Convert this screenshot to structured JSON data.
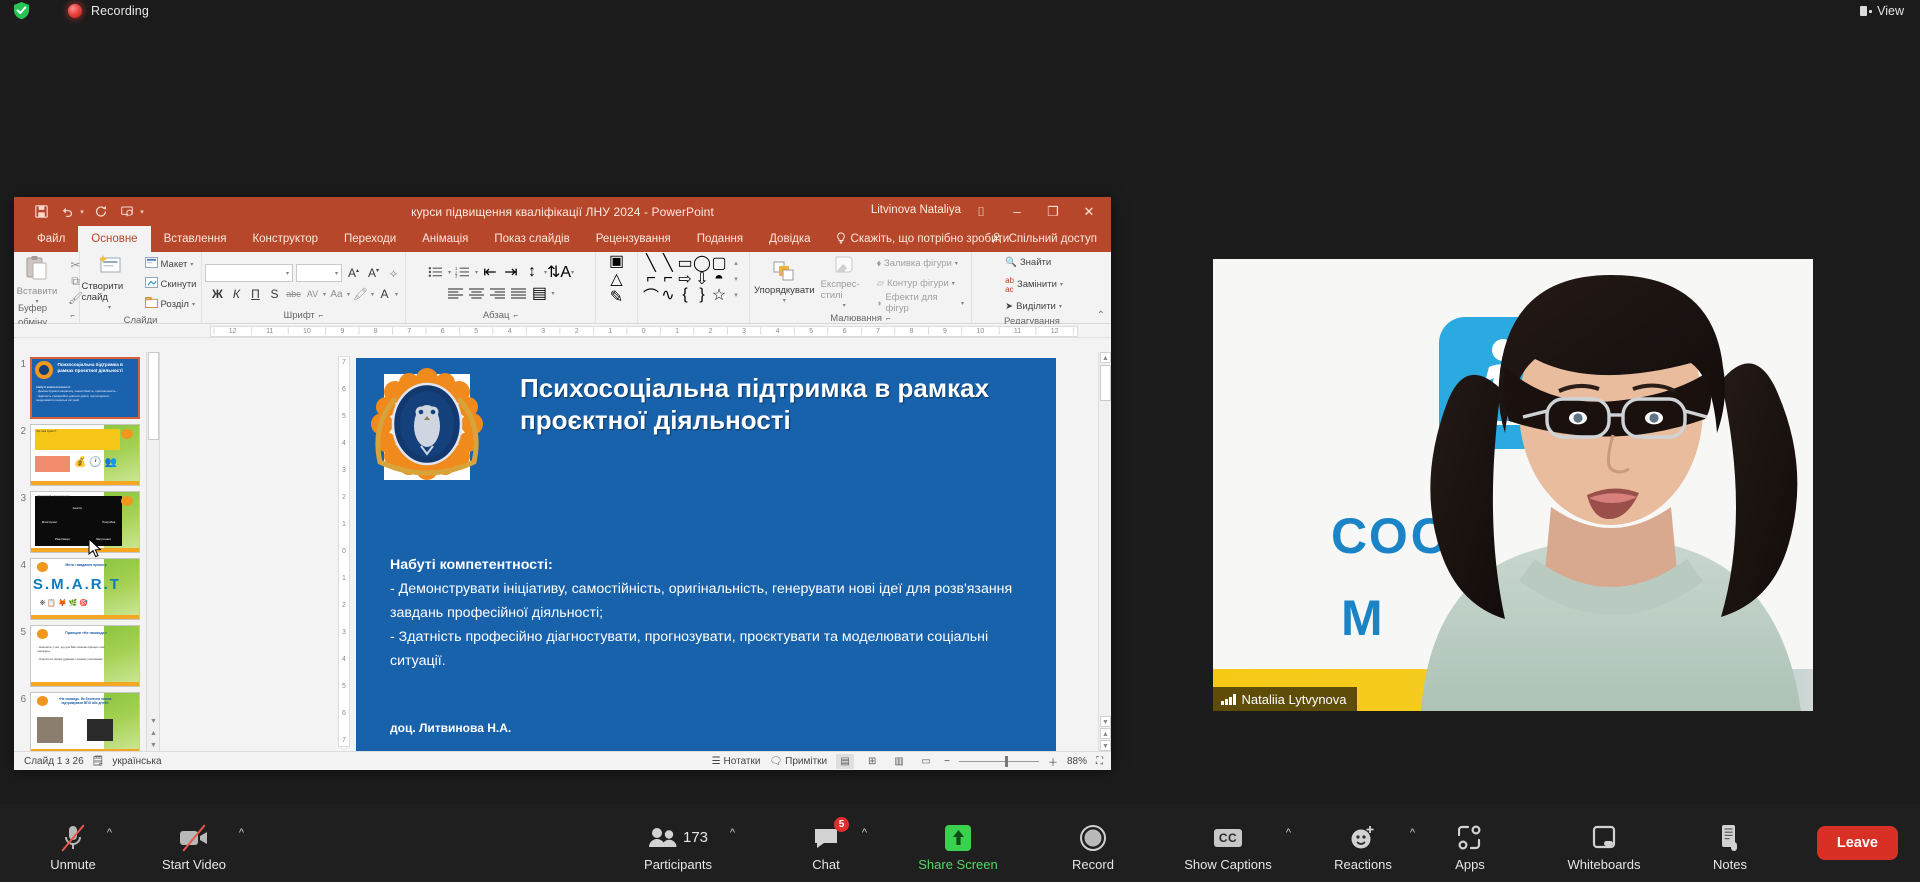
{
  "zoom_topbar": {
    "shield_icon": "shield-check-icon",
    "recording_label": "Recording",
    "view_button": "View",
    "view_icon": "layout-view-icon"
  },
  "powerpoint": {
    "title": "курси підвищення кваліфікації ЛНУ 2024  -  PowerPoint",
    "user": "Litvinova Nataliya",
    "quick_access": [
      {
        "name": "save-icon",
        "glyph": "💾"
      },
      {
        "name": "undo-icon",
        "glyph": "↶"
      },
      {
        "name": "redo-icon",
        "glyph": "↻"
      },
      {
        "name": "start-presentation-icon",
        "glyph": "▷"
      }
    ],
    "window_controls": {
      "ribbon_display": "⌷",
      "minimize": "–",
      "restore": "❐",
      "close": "✕"
    },
    "tabs": [
      "Файл",
      "Основне",
      "Вставлення",
      "Конструктор",
      "Переходи",
      "Анімація",
      "Показ слайдів",
      "Рецензування",
      "Подання",
      "Довідка"
    ],
    "active_tab": "Основне",
    "tell_me": "Скажіть, що потрібно зробити",
    "share": "Спільний доступ",
    "ribbon_groups": [
      {
        "name": "Буфер обміну",
        "items": [
          "Вставити"
        ]
      },
      {
        "name": "Слайди",
        "items": [
          "Створити слайд",
          "Макет",
          "Скинути",
          "Розділ"
        ]
      },
      {
        "name": "Шрифт",
        "items": [
          "Ж",
          "К",
          "П",
          "S",
          "abc",
          "AV",
          "Aa",
          "A"
        ]
      },
      {
        "name": "Абзац",
        "items": []
      },
      {
        "name": "Малювання",
        "items": [
          "Упорядкувати",
          "Експрес-стилі",
          "Заливка фігури",
          "Контур фігури",
          "Ефекти для фігур"
        ]
      },
      {
        "name": "Редагування",
        "items": [
          "Знайти",
          "Замінити",
          "Виділити"
        ]
      }
    ],
    "font_name": "",
    "font_size": "",
    "ruler_ticks": [
      "12",
      "11",
      "10",
      "9",
      "8",
      "7",
      "6",
      "5",
      "4",
      "3",
      "2",
      "1",
      "0",
      "1",
      "2",
      "3",
      "4",
      "5",
      "6",
      "7",
      "8",
      "9",
      "10",
      "11",
      "12"
    ],
    "ruler_v_ticks": [
      "7",
      "6",
      "5",
      "4",
      "3",
      "2",
      "1",
      "0",
      "1",
      "2",
      "3",
      "4",
      "5",
      "6",
      "7"
    ],
    "status": {
      "slide_counter": "Слайд 1 з 26",
      "language_icon": "spellcheck-icon",
      "language": "українська",
      "notes": "Нотатки",
      "comments": "Примітки",
      "zoom_level": "88%",
      "view_buttons": [
        "normal-view",
        "slide-sorter-view",
        "reading-view",
        "slideshow-view"
      ],
      "fit_icon": "fit-to-window-icon"
    },
    "thumbnails": [
      {
        "number": "1",
        "selected": true,
        "title": "Психосоціальна підтримка в рамках проєктної діяльності"
      },
      {
        "number": "2",
        "selected": false,
        "title": "Що таке проєкт?"
      },
      {
        "number": "3",
        "selected": false,
        "title": "Життєвий цикл проєкту"
      },
      {
        "number": "4",
        "selected": false,
        "title": "Мета і завдання проєкту"
      },
      {
        "number": "5",
        "selected": false,
        "title": "Принцип «Не нашкодь»"
      },
      {
        "number": "6",
        "selected": false,
        "title": "«Не нашкодь. Як безпечно можна підтримувати ВПО або дітей»"
      }
    ],
    "slide": {
      "title": "Психосоціальна підтримка в рамках проєктної діяльності",
      "body_heading": "Набуті компетентності:",
      "body_lines": [
        "- Демонструвати ініціативу, самостійність, оригінальність, генерувати нові ідеї для розв'язання завдань професійної діяльності;",
        "- Здатність професійно діагностувати, прогнозувати, проєктувати та моделювати соціальні ситуації."
      ],
      "author": "доц. Литвинова Н.А.",
      "background_color": "#1862ac",
      "text_color": "#ffffff"
    }
  },
  "video": {
    "participant_name": "Nataliia Lytvynova",
    "signal_icon": "signal-bars-icon",
    "background_text_1": "СОС",
    "background_text_2": "М",
    "logo_color": "#2aaae1"
  },
  "zoom_toolbar": {
    "items": [
      {
        "label": "Unmute",
        "icon": "microphone-muted-icon",
        "caret": true,
        "badge": null,
        "color": null
      },
      {
        "label": "Start Video",
        "icon": "video-camera-off-icon",
        "caret": true,
        "badge": null,
        "color": null
      },
      {
        "label": "Participants",
        "icon": "participants-icon",
        "caret": true,
        "badge": null,
        "count": "173",
        "color": null
      },
      {
        "label": "Chat",
        "icon": "chat-bubble-icon",
        "caret": true,
        "badge": "5",
        "color": null
      },
      {
        "label": "Share Screen",
        "icon": "share-screen-icon",
        "caret": false,
        "badge": null,
        "color": "#5ad469"
      },
      {
        "label": "Record",
        "icon": "record-circle-icon",
        "caret": false,
        "badge": null,
        "color": null
      },
      {
        "label": "Show Captions",
        "icon": "closed-captions-icon",
        "caret": true,
        "badge": null,
        "color": null
      },
      {
        "label": "Reactions",
        "icon": "reactions-smiley-icon",
        "caret": true,
        "badge": null,
        "color": null
      },
      {
        "label": "Apps",
        "icon": "apps-icon",
        "caret": false,
        "badge": null,
        "color": null
      },
      {
        "label": "Whiteboards",
        "icon": "whiteboard-icon",
        "caret": false,
        "badge": null,
        "color": null
      },
      {
        "label": "Notes",
        "icon": "notes-icon",
        "caret": false,
        "badge": null,
        "color": null
      }
    ],
    "leave_button": "Leave",
    "leave_color": "#d93025"
  }
}
